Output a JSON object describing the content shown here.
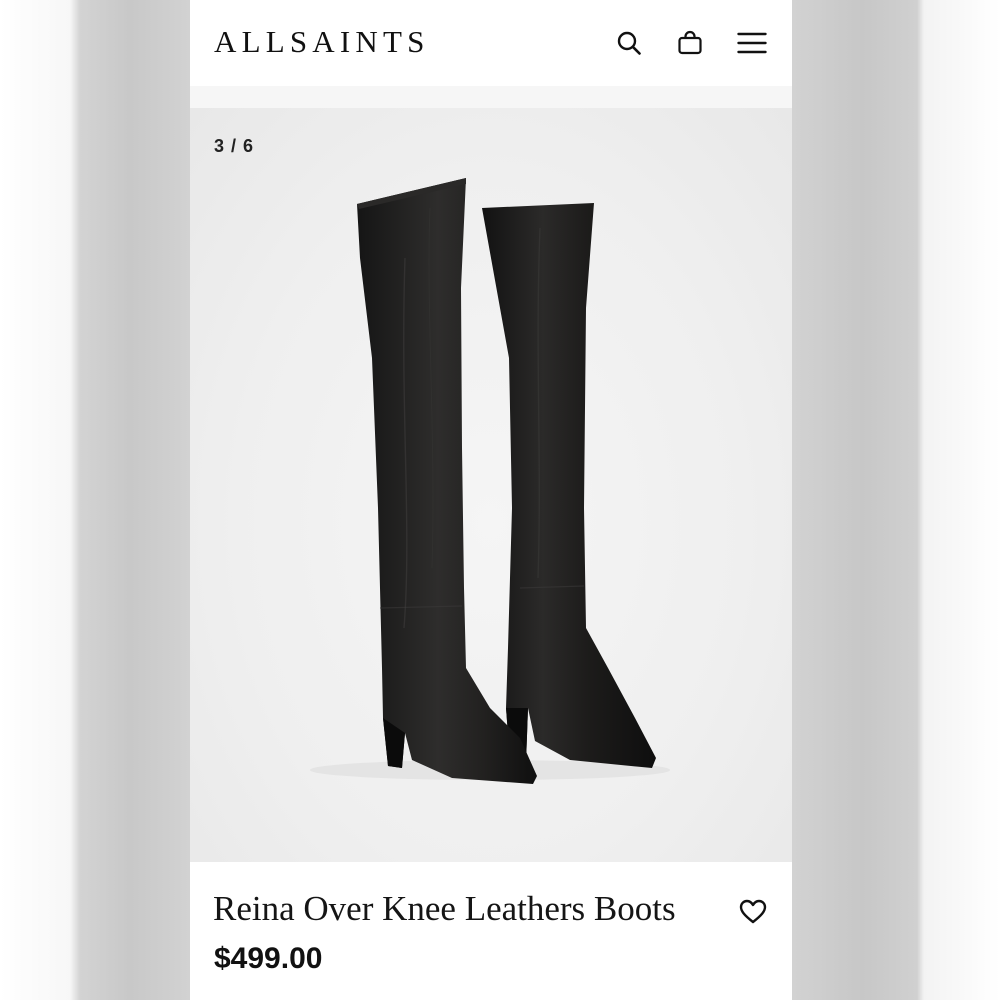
{
  "header": {
    "brand": "ALLSAINTS",
    "icons": [
      "search-icon",
      "shopping-bag-icon",
      "hamburger-menu-icon"
    ]
  },
  "gallery": {
    "counter": "3 / 6",
    "image": "black over-knee leather boots pair"
  },
  "product": {
    "title": "Reina Over Knee Leathers Boots",
    "price": "$499.00",
    "wishlist_icon": "heart-outline-icon"
  },
  "colors": {
    "text": "#111111",
    "background": "#ffffff",
    "image_bg": "#efefef",
    "boot_leather": "#1c1b1a"
  }
}
